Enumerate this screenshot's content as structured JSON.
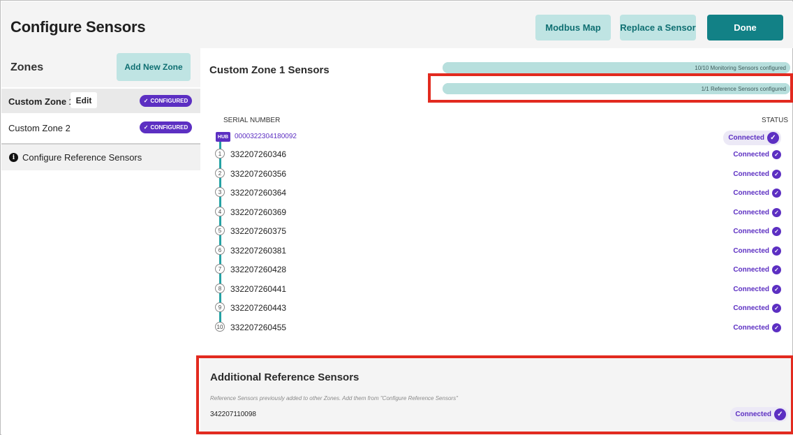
{
  "header": {
    "title": "Configure Sensors",
    "buttons": {
      "modbus": "Modbus Map",
      "replace": "Replace a Sensor",
      "done": "Done"
    }
  },
  "sidebar": {
    "title": "Zones",
    "add_zone_label": "Add New Zone",
    "zones": [
      {
        "name": "Custom Zone 1",
        "edit_label": "Edit",
        "badge": "CONFIGURED",
        "active": true
      },
      {
        "name": "Custom Zone 2",
        "badge": "CONFIGURED",
        "active": false
      }
    ],
    "reference_label": "Configure Reference Sensors"
  },
  "main": {
    "zone_title": "Custom Zone 1 Sensors",
    "progress": [
      {
        "label": "10/10 Monitoring Sensors configured",
        "fraction": 1.0
      },
      {
        "label": "1/1 Reference Sensors configured",
        "fraction": 1.0
      }
    ],
    "columns": {
      "serial": "SERIAL NUMBER",
      "status": "STATUS"
    },
    "hub": {
      "tag": "HUB",
      "serial": "0000322304180092",
      "status": "Connected"
    },
    "sensors": [
      {
        "num": "1",
        "serial": "332207260346",
        "status": "Connected"
      },
      {
        "num": "2",
        "serial": "332207260356",
        "status": "Connected"
      },
      {
        "num": "3",
        "serial": "332207260364",
        "status": "Connected"
      },
      {
        "num": "4",
        "serial": "332207260369",
        "status": "Connected"
      },
      {
        "num": "5",
        "serial": "332207260375",
        "status": "Connected"
      },
      {
        "num": "6",
        "serial": "332207260381",
        "status": "Connected"
      },
      {
        "num": "7",
        "serial": "332207260428",
        "status": "Connected"
      },
      {
        "num": "8",
        "serial": "332207260441",
        "status": "Connected"
      },
      {
        "num": "9",
        "serial": "332207260443",
        "status": "Connected"
      },
      {
        "num": "10",
        "serial": "332207260455",
        "status": "Connected"
      }
    ]
  },
  "additional": {
    "title": "Additional Reference Sensors",
    "description": "Reference Sensors previously added to other Zones. Add them from \"Configure Reference Sensors\"",
    "serial": "342207110098",
    "status": "Connected"
  },
  "colors": {
    "accent_purple": "#5c2fc2",
    "teal": "#128186",
    "teal_light": "#bfe4e3",
    "highlight_red": "#e22a1f"
  },
  "icons": {
    "check": "check-icon",
    "info": "info-icon"
  }
}
